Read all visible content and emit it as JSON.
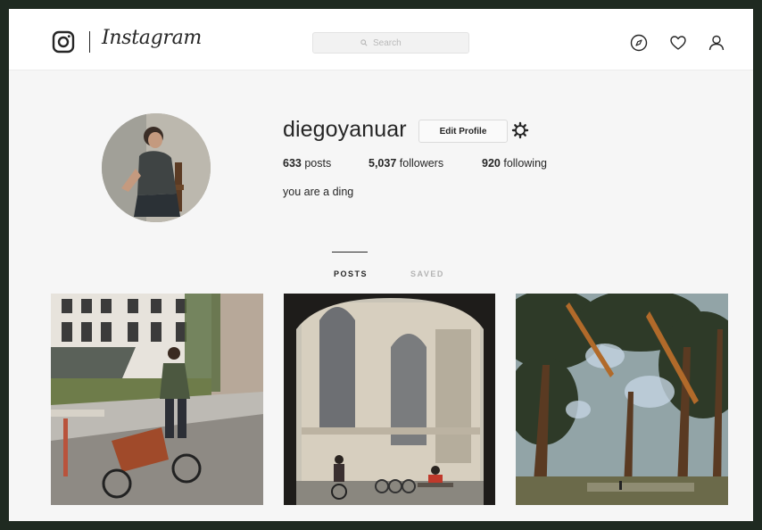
{
  "app": {
    "wordmark": "Instagram"
  },
  "search": {
    "placeholder": "Search"
  },
  "profile": {
    "username": "diegoyanuar",
    "edit_label": "Edit Profile",
    "posts_count": "633",
    "posts_label": "posts",
    "followers_count": "5,037",
    "followers_label": "followers",
    "following_count": "920",
    "following_label": "following",
    "bio": "you are a ding"
  },
  "tabs": [
    {
      "label": "POSTS",
      "active": true
    },
    {
      "label": "SAVED",
      "active": false
    }
  ],
  "nav_icons": [
    "compass-icon",
    "heart-icon",
    "person-icon"
  ],
  "posts": [
    {
      "subject": "cyclist-cargo-bike-street"
    },
    {
      "subject": "church-archway-cyclists"
    },
    {
      "subject": "trees-forest-path"
    }
  ],
  "colors": {
    "text": "#262626",
    "muted": "#b3b3b3",
    "background": "#f6f6f6",
    "frame": "#1f2a21"
  }
}
